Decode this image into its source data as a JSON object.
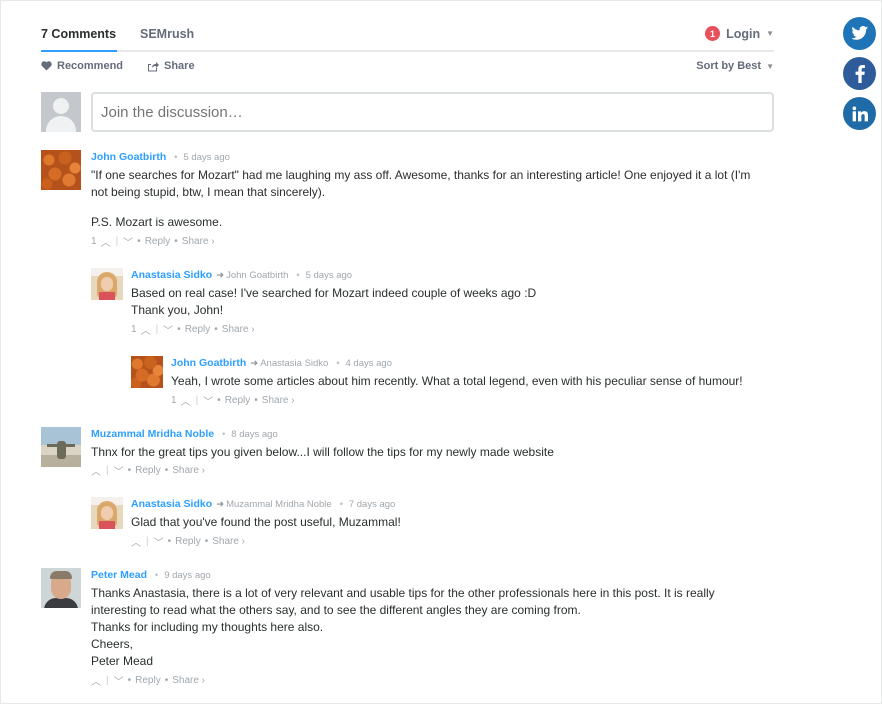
{
  "header": {
    "tab_comments": "7 Comments",
    "tab_site": "SEMrush",
    "notification_count": "1",
    "login_label": "Login"
  },
  "toolbar": {
    "recommend_label": "Recommend",
    "share_label": "Share",
    "sort_label": "Sort by Best"
  },
  "composer": {
    "placeholder": "Join the discussion…"
  },
  "comments": [
    {
      "author": "John Goatbirth",
      "reply_to": "",
      "time": "5 days ago",
      "lines": [
        "\"If one searches for Mozart\" had me laughing my ass off. Awesome, thanks for an interesting article! One enjoyed it a lot (I'm",
        "not being stupid, btw, I mean that sincerely)."
      ],
      "extra": "P.S. Mozart is awesome.",
      "votes": "1",
      "reply": "Reply",
      "share": "Share ›"
    },
    {
      "author": "Anastasia Sidko",
      "reply_to": "John Goatbirth",
      "time": "5 days ago",
      "lines": [
        "Based on real case! I've searched for Mozart indeed couple of weeks ago :D",
        "Thank you, John!"
      ],
      "votes": "1",
      "reply": "Reply",
      "share": "Share ›"
    },
    {
      "author": "John Goatbirth",
      "reply_to": "Anastasia Sidko",
      "time": "4 days ago",
      "lines": [
        "Yeah, I wrote some articles about him recently. What a total legend, even with his peculiar sense of humour!"
      ],
      "votes": "1",
      "reply": "Reply",
      "share": "Share ›"
    },
    {
      "author": "Muzammal Mridha Noble",
      "reply_to": "",
      "time": "8 days ago",
      "lines": [
        "Thnx for the great tips you given below...I will follow the tips for my newly made website"
      ],
      "votes": "",
      "reply": "Reply",
      "share": "Share ›"
    },
    {
      "author": "Anastasia Sidko",
      "reply_to": "Muzammal Mridha Noble",
      "time": "7 days ago",
      "lines": [
        "Glad that you've found the post useful, Muzammal!"
      ],
      "votes": "",
      "reply": "Reply",
      "share": "Share ›"
    },
    {
      "author": "Peter Mead",
      "reply_to": "",
      "time": "9 days ago",
      "lines": [
        "Thanks Anastasia, there is a lot of very relevant and usable tips for the other professionals here in this post. It is really",
        "interesting to read what the others say, and to see the different angles they are coming from.",
        "Thanks for including my thoughts here also.",
        "Cheers,",
        "Peter Mead"
      ],
      "votes": "",
      "reply": "Reply",
      "share": "Share ›"
    }
  ],
  "social": {
    "twitter_icon": "twitter-icon",
    "facebook_icon": "facebook-icon",
    "linkedin_icon": "linkedin-icon"
  },
  "colors": {
    "accent": "#2e9fff",
    "badge": "#e8505b",
    "muted": "#a0a7ad"
  }
}
